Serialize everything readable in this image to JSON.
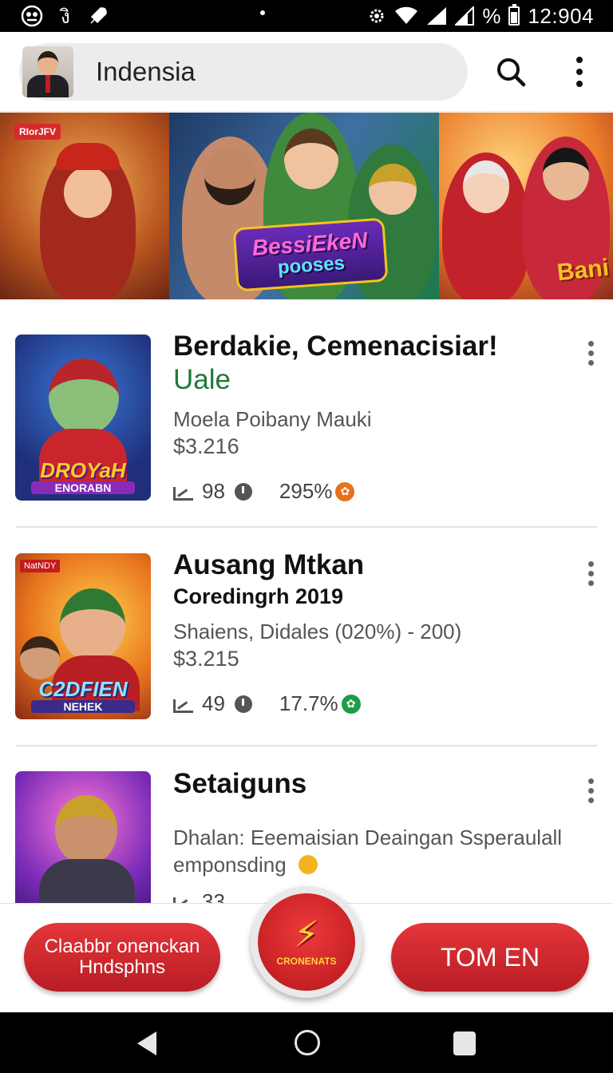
{
  "status_bar": {
    "time": "12:904",
    "battery_label": "%",
    "left_glyph": "งิ"
  },
  "app_bar": {
    "title": "Indensia"
  },
  "banner": {
    "tag": "RIorJFV",
    "logo_line1": "BessiEkeN",
    "logo_line2": "pooses",
    "edge_text": "Bani"
  },
  "items": [
    {
      "title": "Berdakie, Cemenacisiar!",
      "subtitle": "Uale",
      "subtitle_style": "green",
      "description": "Moela Poibany Mauki",
      "price": "$3.216",
      "stat1": "98",
      "stat2": "295%",
      "badge_color": "#e8711c",
      "thumb_title": "DROYaH",
      "thumb_sub": "ENORABN",
      "thumb_tag": ""
    },
    {
      "title": "Ausang Mtkan",
      "subtitle": "Coredingrh 2019",
      "subtitle_style": "dark",
      "description": "Shaiens, Didales (020%) - 200)",
      "price": "$3.215",
      "stat1": "49",
      "stat2": "17.7%",
      "badge_color": "#1e9c4a",
      "thumb_title": "C2DFIEN",
      "thumb_sub": "NEHEK",
      "thumb_tag": "NatNDY"
    },
    {
      "title": "Setaiguns",
      "description_line1": "Dhalan: Eeemaisian Deaingan Ssperaulall",
      "description_line2": "emponsding",
      "stat1": "33"
    }
  ],
  "bottom_bar": {
    "left_button": "Claabbr onenckan Hndsphns",
    "center_label": "CRONENATS",
    "right_button": "TOM EN"
  }
}
